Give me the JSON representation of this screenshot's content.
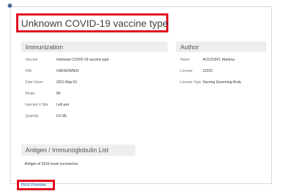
{
  "title": "Unknown COVID-19 vaccine type",
  "immunization": {
    "heading": "Immunization",
    "fields": [
      {
        "label": "Vaccine",
        "value": "Unknown COVID-19 vaccine type"
      },
      {
        "label": "DIN",
        "value": "UNKNOWN03"
      },
      {
        "label": "Date Given",
        "value": "2021-May-01"
      },
      {
        "label": "Route",
        "value": "IM"
      },
      {
        "label": "Injected X Site",
        "value": "Left arm"
      },
      {
        "label": "Quantity",
        "value": "0.5 ML"
      }
    ]
  },
  "author": {
    "heading": "Author",
    "fields": [
      {
        "label": "Name",
        "value": "ACCOUNT, Marlena"
      },
      {
        "label": "License",
        "value": "22222"
      },
      {
        "label": "License Type",
        "value": "Nursing Governing Body"
      }
    ]
  },
  "antigen": {
    "heading": "Antigen / Immunoglobulin List",
    "items": [
      "Antigen of 2019 novel coronavirus"
    ]
  },
  "print_preview_label": "Print Preview"
}
